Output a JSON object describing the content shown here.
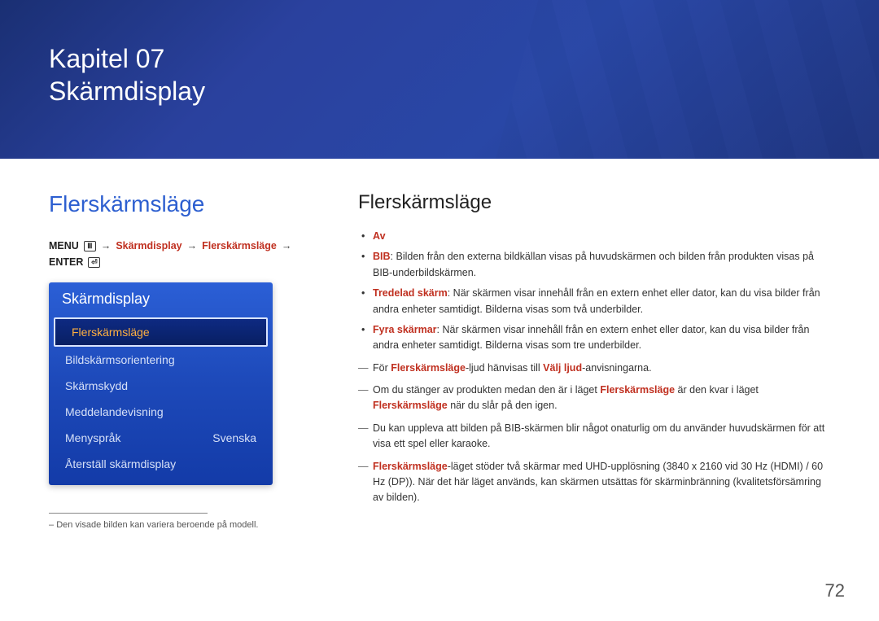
{
  "banner": {
    "line1": "Kapitel 07",
    "line2": "Skärmdisplay"
  },
  "left": {
    "title": "Flerskärmsläge",
    "breadcrumb": {
      "menu": "MENU",
      "p1": "Skärmdisplay",
      "p2": "Flerskärmsläge",
      "enter": "ENTER"
    },
    "panel": {
      "header": "Skärmdisplay",
      "items": [
        {
          "label": "Flerskärmsläge",
          "value": "",
          "selected": true
        },
        {
          "label": "Bildskärmsorientering",
          "value": "",
          "selected": false
        },
        {
          "label": "Skärmskydd",
          "value": "",
          "selected": false
        },
        {
          "label": "Meddelandevisning",
          "value": "",
          "selected": false
        },
        {
          "label": "Menyspråk",
          "value": "Svenska",
          "selected": false
        },
        {
          "label": "Återställ skärmdisplay",
          "value": "",
          "selected": false
        }
      ]
    },
    "footnote": "Den visade bilden kan variera beroende på modell."
  },
  "right": {
    "title": "Flerskärmsläge",
    "bullets": {
      "b0": {
        "label": "Av"
      },
      "b1": {
        "label": "BIB",
        "text": ": Bilden från den externa bildkällan visas på huvudskärmen och bilden från produkten visas på BIB-underbildskärmen."
      },
      "b2": {
        "label": "Tredelad skärm",
        "text": ": När skärmen visar innehåll från en extern enhet eller dator, kan du visa bilder från andra enheter samtidigt. Bilderna visas som två underbilder."
      },
      "b3": {
        "label": "Fyra skärmar",
        "text": ": När skärmen visar innehåll från en extern enhet eller dator, kan du visa bilder från andra enheter samtidigt. Bilderna visas som tre underbilder."
      }
    },
    "notes": {
      "n0": {
        "pre": "För ",
        "k1": "Flerskärmsläge",
        "mid": "-ljud hänvisas till ",
        "k2": "Välj ljud",
        "post": "-anvisningarna."
      },
      "n1": {
        "pre": "Om du stänger av produkten medan den är i läget ",
        "k1": "Flerskärmsläge",
        "mid": " är den kvar i läget ",
        "k2": "Flerskärmsläge",
        "post": " när du slår på den igen."
      },
      "n2": {
        "text": "Du kan uppleva att bilden på BIB-skärmen blir något onaturlig om du använder huvudskärmen för att visa ett spel eller karaoke."
      },
      "n3": {
        "k1": "Flerskärmsläge",
        "text": "-läget stöder två skärmar med UHD-upplösning (3840 x 2160 vid 30 Hz (HDMI) / 60 Hz (DP)). När det här läget används, kan skärmen utsättas för skärminbränning (kvalitetsförsämring av bilden)."
      }
    }
  },
  "page": "72"
}
